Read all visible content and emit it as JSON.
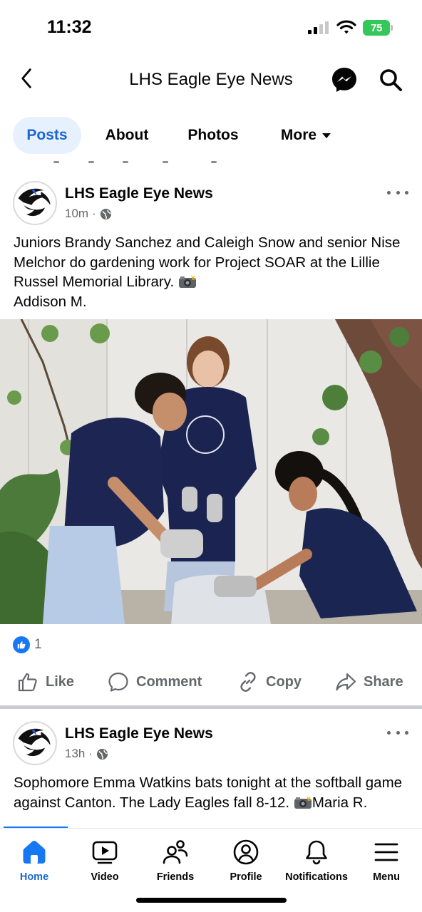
{
  "status_bar": {
    "time": "11:32",
    "battery": "75",
    "battery_color": "#34c759",
    "icons": [
      "signal-icon",
      "wifi-icon",
      "battery-icon"
    ]
  },
  "header": {
    "title": "LHS Eagle Eye News",
    "icons": [
      "back-arrow-icon",
      "messenger-icon",
      "search-icon"
    ]
  },
  "tabs": [
    {
      "label": "Posts",
      "active": true
    },
    {
      "label": "About"
    },
    {
      "label": "Photos"
    },
    {
      "label": "More"
    }
  ],
  "posts": [
    {
      "author": "LHS Eagle Eye News",
      "time": "10m",
      "separator": "·",
      "caption_text": "Juniors Brandy Sanchez and Caleigh Snow and senior Nise Melchor do gardening work for Project SOAR at the Lillie Russel Memorial Library.",
      "caption_credit": "Addison M.",
      "reaction_count": "1",
      "actions": {
        "like": "Like",
        "comment": "Comment",
        "copy": "Copy",
        "share": "Share"
      }
    },
    {
      "author": "LHS Eagle Eye News",
      "time": "13h",
      "separator": "·",
      "caption_text": "Sophomore Emma Watkins bats tonight at the softball game against Canton. The Lady Eagles fall 8-12.",
      "caption_credit": "Maria R."
    }
  ],
  "bottom_nav": [
    {
      "label": "Home",
      "icon": "home-icon",
      "active": true
    },
    {
      "label": "Video",
      "icon": "video-icon"
    },
    {
      "label": "Friends",
      "icon": "friends-icon"
    },
    {
      "label": "Profile",
      "icon": "profile-icon"
    },
    {
      "label": "Notifications",
      "icon": "bell-icon"
    },
    {
      "label": "Menu",
      "icon": "menu-icon"
    }
  ],
  "colors": {
    "accent": "#1877f2",
    "active_tab_bg": "#e7f0fd",
    "active_text": "#1b66d2",
    "secondary_text": "#65676b"
  }
}
